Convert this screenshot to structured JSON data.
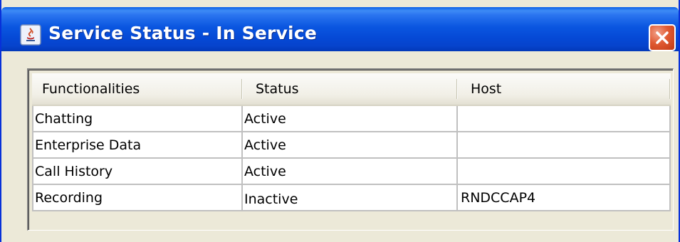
{
  "window": {
    "title": "Service Status - In Service",
    "icon": "java-app-icon",
    "close_icon": "close-icon"
  },
  "table": {
    "columns": [
      "Functionalities",
      "Status",
      "Host"
    ],
    "rows": [
      {
        "functionality": "Chatting",
        "status": "Active",
        "host": ""
      },
      {
        "functionality": "Enterprise Data",
        "status": "Active",
        "host": ""
      },
      {
        "functionality": "Call History",
        "status": "Active",
        "host": ""
      },
      {
        "functionality": "Recording",
        "status": "Inactive",
        "host": "RNDCCAP4"
      }
    ]
  },
  "colors": {
    "titlebar": "#0549d6",
    "close_button": "#e05a32",
    "panel_background": "#ece9d8"
  }
}
